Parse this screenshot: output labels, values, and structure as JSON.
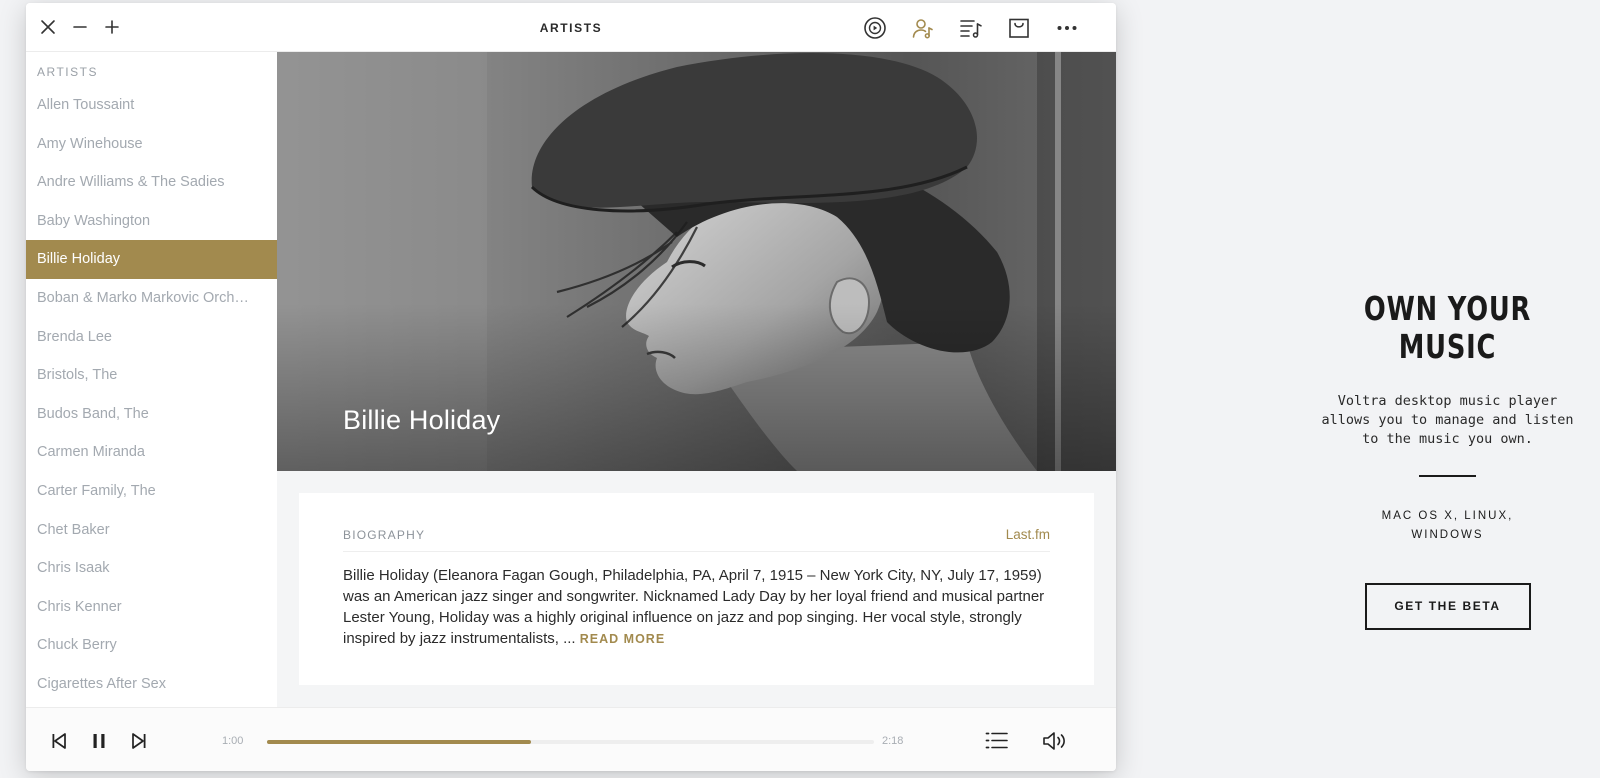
{
  "window": {
    "title": "ARTISTS",
    "controls": {
      "close": "close-icon",
      "minimize": "minus-icon",
      "add": "plus-icon"
    },
    "toolbar": [
      "disc-icon",
      "artist-icon",
      "playlist-icon",
      "cart-icon",
      "more-icon"
    ],
    "accent_color": "#a28a4e"
  },
  "sidebar": {
    "heading": "ARTISTS",
    "items": [
      {
        "label": "Allen Toussaint"
      },
      {
        "label": "Amy Winehouse"
      },
      {
        "label": "Andre Williams & The Sadies"
      },
      {
        "label": "Baby Washington"
      },
      {
        "label": "Billie Holiday",
        "active": true
      },
      {
        "label": "Boban & Marko Markovic Orch…"
      },
      {
        "label": "Brenda Lee"
      },
      {
        "label": "Bristols, The"
      },
      {
        "label": "Budos Band, The"
      },
      {
        "label": "Carmen Miranda"
      },
      {
        "label": "Carter Family, The"
      },
      {
        "label": "Chet Baker"
      },
      {
        "label": "Chris Isaak"
      },
      {
        "label": "Chris Kenner"
      },
      {
        "label": "Chuck Berry"
      },
      {
        "label": "Cigarettes After Sex"
      }
    ]
  },
  "artist": {
    "name": "Billie Holiday",
    "biography": {
      "label": "BIOGRAPHY",
      "source": "Last.fm",
      "text": "Billie Holiday (Eleanora Fagan Gough, Philadelphia, PA, April 7, 1915 – New York City, NY, July 17, 1959) was an American jazz singer and songwriter. Nicknamed Lady Day by her loyal friend and musical partner Lester Young, Holiday was a highly original influence on jazz and pop singing. Her vocal style, strongly inspired by jazz instrumentalists, ...",
      "read_more": "READ MORE"
    }
  },
  "player": {
    "elapsed": "1:00",
    "total": "2:18",
    "progress_fraction": 0.435
  },
  "promo": {
    "heading_line1": "OWN YOUR",
    "heading_line2": "MUSIC",
    "description": "Voltra desktop music player allows you to manage and listen to the music you own.",
    "platforms": "MAC OS X, LINUX, WINDOWS",
    "cta": "GET THE BETA"
  }
}
